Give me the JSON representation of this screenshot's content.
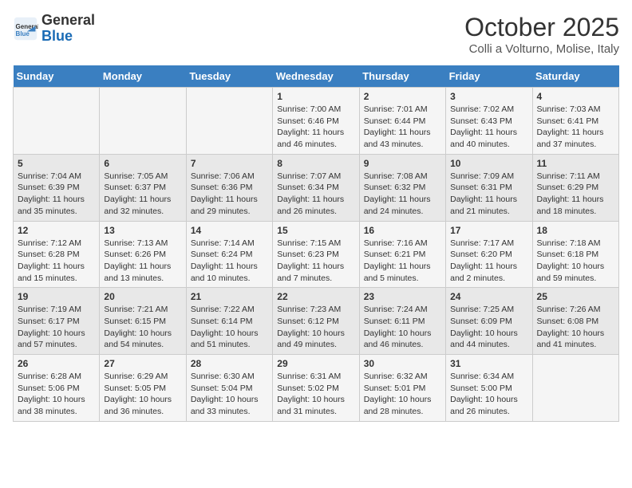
{
  "header": {
    "logo_general": "General",
    "logo_blue": "Blue",
    "month_title": "October 2025",
    "subtitle": "Colli a Volturno, Molise, Italy"
  },
  "weekdays": [
    "Sunday",
    "Monday",
    "Tuesday",
    "Wednesday",
    "Thursday",
    "Friday",
    "Saturday"
  ],
  "weeks": [
    [
      {
        "day": "",
        "info": ""
      },
      {
        "day": "",
        "info": ""
      },
      {
        "day": "",
        "info": ""
      },
      {
        "day": "1",
        "info": "Sunrise: 7:00 AM\nSunset: 6:46 PM\nDaylight: 11 hours and 46 minutes."
      },
      {
        "day": "2",
        "info": "Sunrise: 7:01 AM\nSunset: 6:44 PM\nDaylight: 11 hours and 43 minutes."
      },
      {
        "day": "3",
        "info": "Sunrise: 7:02 AM\nSunset: 6:43 PM\nDaylight: 11 hours and 40 minutes."
      },
      {
        "day": "4",
        "info": "Sunrise: 7:03 AM\nSunset: 6:41 PM\nDaylight: 11 hours and 37 minutes."
      }
    ],
    [
      {
        "day": "5",
        "info": "Sunrise: 7:04 AM\nSunset: 6:39 PM\nDaylight: 11 hours and 35 minutes."
      },
      {
        "day": "6",
        "info": "Sunrise: 7:05 AM\nSunset: 6:37 PM\nDaylight: 11 hours and 32 minutes."
      },
      {
        "day": "7",
        "info": "Sunrise: 7:06 AM\nSunset: 6:36 PM\nDaylight: 11 hours and 29 minutes."
      },
      {
        "day": "8",
        "info": "Sunrise: 7:07 AM\nSunset: 6:34 PM\nDaylight: 11 hours and 26 minutes."
      },
      {
        "day": "9",
        "info": "Sunrise: 7:08 AM\nSunset: 6:32 PM\nDaylight: 11 hours and 24 minutes."
      },
      {
        "day": "10",
        "info": "Sunrise: 7:09 AM\nSunset: 6:31 PM\nDaylight: 11 hours and 21 minutes."
      },
      {
        "day": "11",
        "info": "Sunrise: 7:11 AM\nSunset: 6:29 PM\nDaylight: 11 hours and 18 minutes."
      }
    ],
    [
      {
        "day": "12",
        "info": "Sunrise: 7:12 AM\nSunset: 6:28 PM\nDaylight: 11 hours and 15 minutes."
      },
      {
        "day": "13",
        "info": "Sunrise: 7:13 AM\nSunset: 6:26 PM\nDaylight: 11 hours and 13 minutes."
      },
      {
        "day": "14",
        "info": "Sunrise: 7:14 AM\nSunset: 6:24 PM\nDaylight: 11 hours and 10 minutes."
      },
      {
        "day": "15",
        "info": "Sunrise: 7:15 AM\nSunset: 6:23 PM\nDaylight: 11 hours and 7 minutes."
      },
      {
        "day": "16",
        "info": "Sunrise: 7:16 AM\nSunset: 6:21 PM\nDaylight: 11 hours and 5 minutes."
      },
      {
        "day": "17",
        "info": "Sunrise: 7:17 AM\nSunset: 6:20 PM\nDaylight: 11 hours and 2 minutes."
      },
      {
        "day": "18",
        "info": "Sunrise: 7:18 AM\nSunset: 6:18 PM\nDaylight: 10 hours and 59 minutes."
      }
    ],
    [
      {
        "day": "19",
        "info": "Sunrise: 7:19 AM\nSunset: 6:17 PM\nDaylight: 10 hours and 57 minutes."
      },
      {
        "day": "20",
        "info": "Sunrise: 7:21 AM\nSunset: 6:15 PM\nDaylight: 10 hours and 54 minutes."
      },
      {
        "day": "21",
        "info": "Sunrise: 7:22 AM\nSunset: 6:14 PM\nDaylight: 10 hours and 51 minutes."
      },
      {
        "day": "22",
        "info": "Sunrise: 7:23 AM\nSunset: 6:12 PM\nDaylight: 10 hours and 49 minutes."
      },
      {
        "day": "23",
        "info": "Sunrise: 7:24 AM\nSunset: 6:11 PM\nDaylight: 10 hours and 46 minutes."
      },
      {
        "day": "24",
        "info": "Sunrise: 7:25 AM\nSunset: 6:09 PM\nDaylight: 10 hours and 44 minutes."
      },
      {
        "day": "25",
        "info": "Sunrise: 7:26 AM\nSunset: 6:08 PM\nDaylight: 10 hours and 41 minutes."
      }
    ],
    [
      {
        "day": "26",
        "info": "Sunrise: 6:28 AM\nSunset: 5:06 PM\nDaylight: 10 hours and 38 minutes."
      },
      {
        "day": "27",
        "info": "Sunrise: 6:29 AM\nSunset: 5:05 PM\nDaylight: 10 hours and 36 minutes."
      },
      {
        "day": "28",
        "info": "Sunrise: 6:30 AM\nSunset: 5:04 PM\nDaylight: 10 hours and 33 minutes."
      },
      {
        "day": "29",
        "info": "Sunrise: 6:31 AM\nSunset: 5:02 PM\nDaylight: 10 hours and 31 minutes."
      },
      {
        "day": "30",
        "info": "Sunrise: 6:32 AM\nSunset: 5:01 PM\nDaylight: 10 hours and 28 minutes."
      },
      {
        "day": "31",
        "info": "Sunrise: 6:34 AM\nSunset: 5:00 PM\nDaylight: 10 hours and 26 minutes."
      },
      {
        "day": "",
        "info": ""
      }
    ]
  ]
}
